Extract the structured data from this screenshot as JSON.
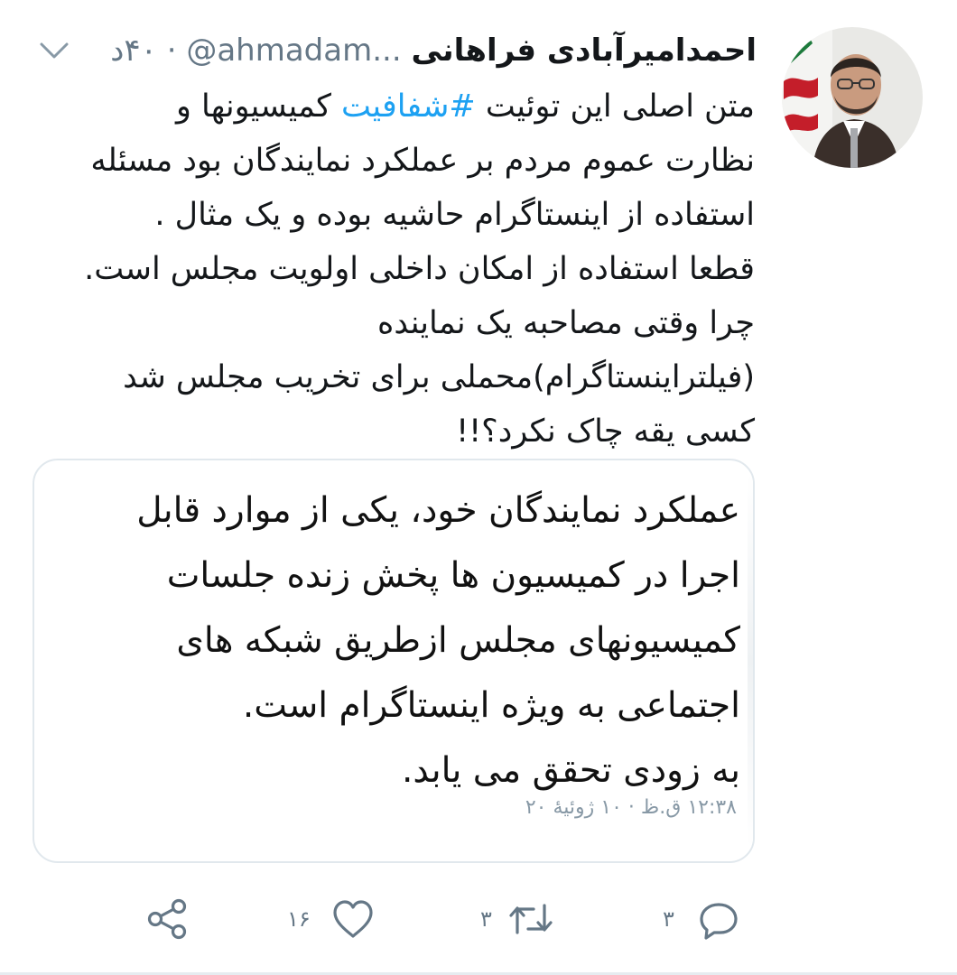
{
  "colors": {
    "accent": "#1da1f2",
    "secondary_text": "#657786",
    "border": "#e1e8ed"
  },
  "tweet": {
    "author_name": "احمدامیرآبادی فراهانی",
    "handle": "@ahmadam...",
    "time": "۴۰د",
    "body": {
      "line1_pre": "متن اصلی این توئیت ",
      "hashtag": "#شفافیت",
      "line1_post": " کمیسیونها و",
      "line2": "نظارت عموم مردم بر عملکرد نمایندگان بود مسئله",
      "line3": "استفاده از اینستاگرام حاشیه بوده و یک مثال .",
      "line4": "قطعا استفاده از امکان داخلی اولویت مجلس است.",
      "line5": "چرا وقتی مصاحبه یک نماینده",
      "line6": "(فیلترا‌ینستاگرام)محملی برای تخریب مجلس شد",
      "line7": "کسی یقه چاک نکرد؟!!"
    },
    "quoted": {
      "line1": "عملکرد نمایندگان خود، یکی از موارد قابل",
      "line2": "اجرا در کمیسیون ها پخش زنده جلسات",
      "line3": "کمیسیونهای مجلس ازطریق شبکه های",
      "line4": "اجتماعی به ویژه اینستاگرام است.",
      "line5": "به زودی تحقق می یابد.",
      "date": "۱۲:۳۸ ق.ظ · ۱۰ ژوئیهٔ ۲۰"
    },
    "actions": {
      "reply_count": "۳",
      "retweet_count": "۳",
      "like_count": "۱۶",
      "icons": [
        "reply-icon",
        "retweet-icon",
        "like-icon",
        "share-icon"
      ]
    }
  }
}
